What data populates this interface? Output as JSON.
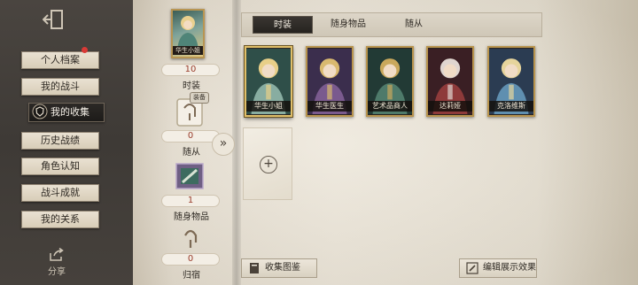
{
  "sidebar": {
    "items": [
      {
        "label": "个人档案",
        "has_notification": true
      },
      {
        "label": "我的战斗"
      },
      {
        "label": "我的收集",
        "active": true
      },
      {
        "label": "历史战绩"
      },
      {
        "label": "角色认知"
      },
      {
        "label": "战斗成就"
      },
      {
        "label": "我的关系"
      }
    ],
    "share_label": "分享"
  },
  "summary": {
    "featured_card_name": "华生小姐",
    "costume_count": "10",
    "costume_label": "时装",
    "equip_badge": "装备",
    "follower_count": "0",
    "follower_label": "随从",
    "accessory_count": "1",
    "accessory_label": "随身物品",
    "returning_count": "0",
    "returning_label": "归宿"
  },
  "tabs": [
    {
      "label": "时装",
      "active": true
    },
    {
      "label": "随身物品"
    },
    {
      "label": "随从"
    }
  ],
  "costumes": [
    {
      "name": "华生小姐",
      "selected": true,
      "palette": [
        "#2f4f49",
        "#88ada1",
        "#e8cf88"
      ]
    },
    {
      "name": "华生医生",
      "palette": [
        "#3b2e4d",
        "#7a5a8e",
        "#d9b96f"
      ]
    },
    {
      "name": "艺术品商人",
      "palette": [
        "#223a35",
        "#4e7a6a",
        "#c9a85c"
      ]
    },
    {
      "name": "达莉娅",
      "palette": [
        "#3a1f24",
        "#8e3a3a",
        "#e0d6d0"
      ]
    },
    {
      "name": "克洛维斯",
      "palette": [
        "#2b3c52",
        "#5f8fb0",
        "#e6d49c"
      ]
    }
  ],
  "add_slot_icon": "plus-icon",
  "footer": {
    "collection_guide_label": "收集图鉴",
    "edit_display_label": "编辑展示效果"
  },
  "colors": {
    "accent_gold": "#b8944e",
    "parchment": "#e6dfd0",
    "dark_panel": "#3e3a36",
    "notification_red": "#d93a36"
  }
}
